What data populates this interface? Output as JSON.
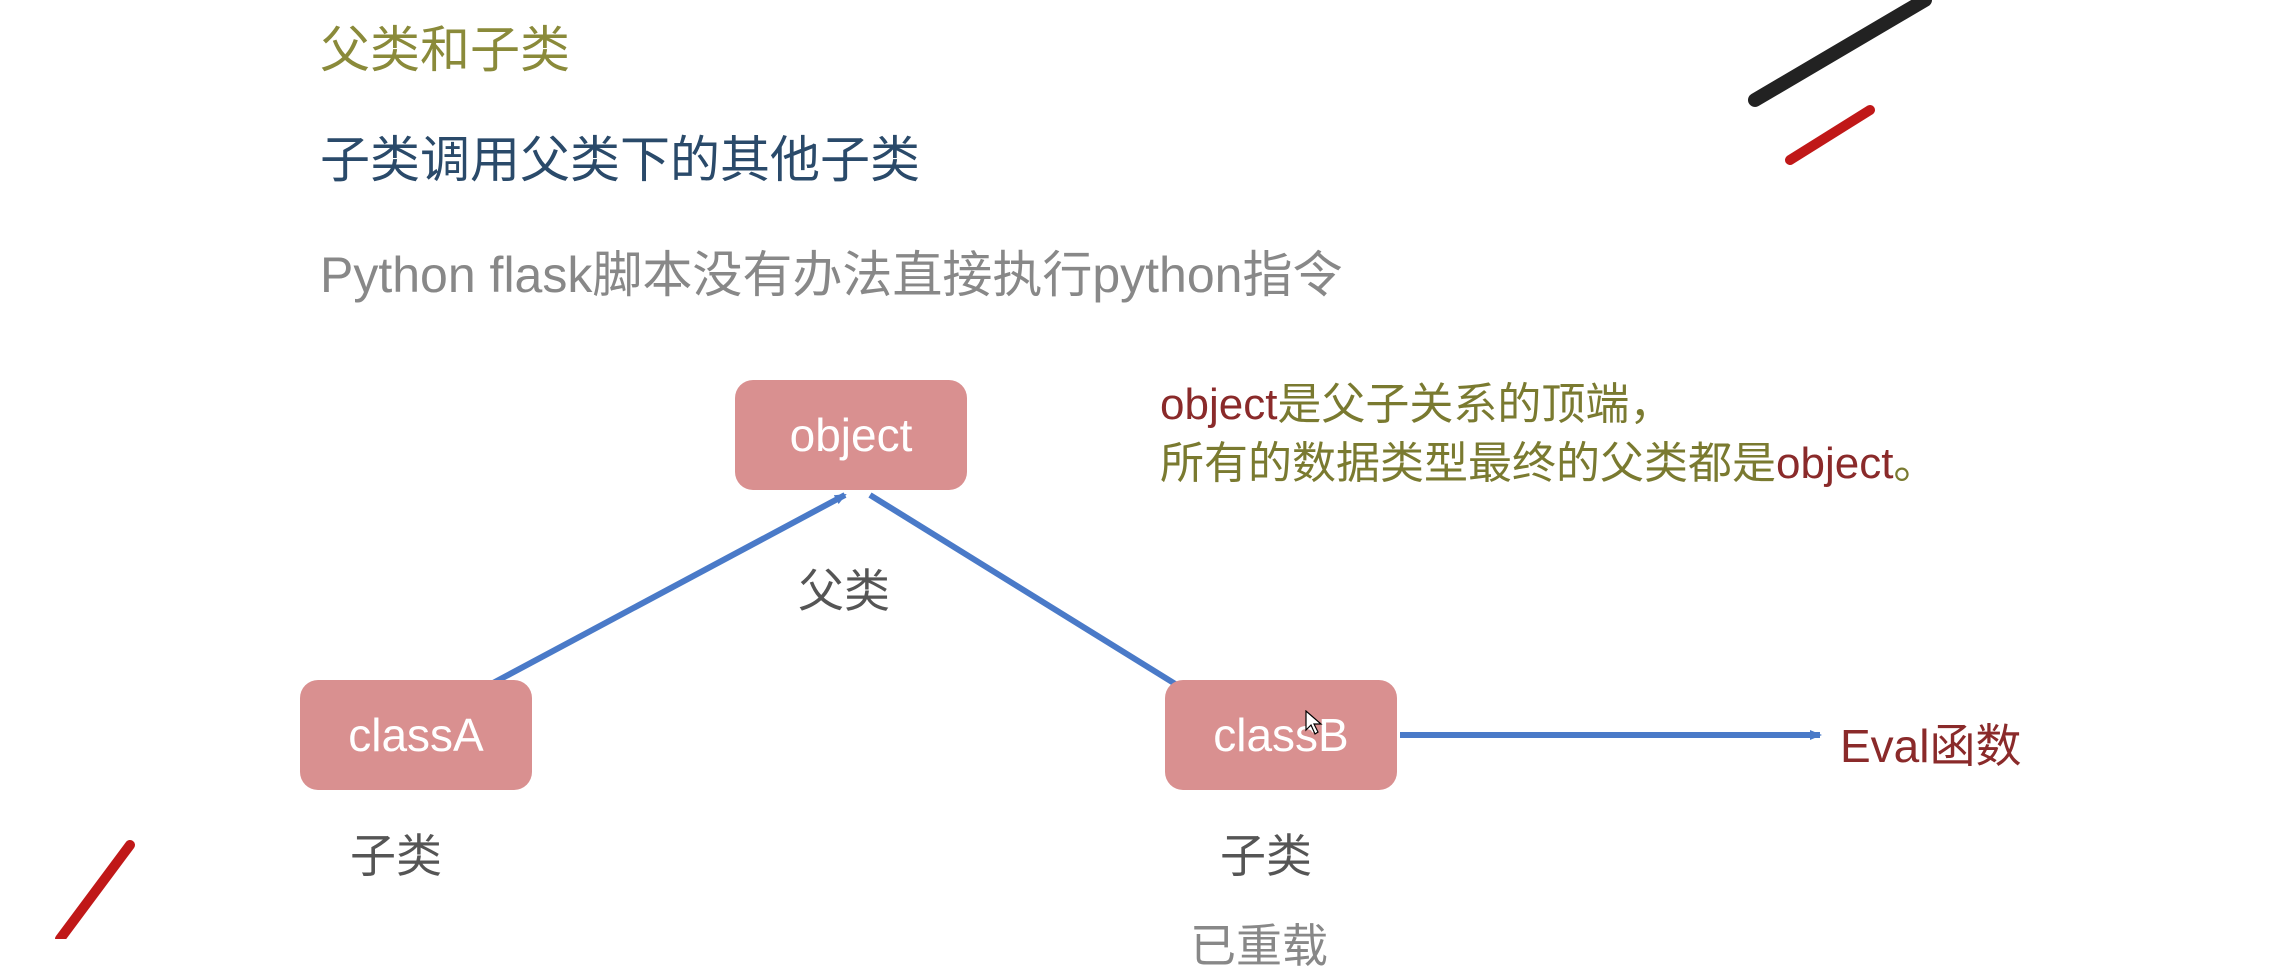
{
  "headings": {
    "h1": "父类和子类",
    "h2": "子类调用父类下的其他子类",
    "h3": "Python flask脚本没有办法直接执行python指令"
  },
  "nodes": {
    "object": "object",
    "classA": "classA",
    "classB": "classB"
  },
  "labels": {
    "parent": "父类",
    "childA": "子类",
    "childB": "子类",
    "overload": "已重载",
    "eval": "Eval函数"
  },
  "annotation": {
    "kw1": "object",
    "line1_rest": "是父子关系的顶端，",
    "line2_a": "所有的数据类型最终的父类都是",
    "kw2": "object",
    "line2_b": "。"
  },
  "colors": {
    "arrow": "#4a7ac8",
    "node_bg": "#d99090",
    "olive": "#8a8a3a",
    "darkblue": "#2a4a6a",
    "gray": "#888888",
    "darkred": "#8a2a2a",
    "red_accent": "#c01818"
  }
}
